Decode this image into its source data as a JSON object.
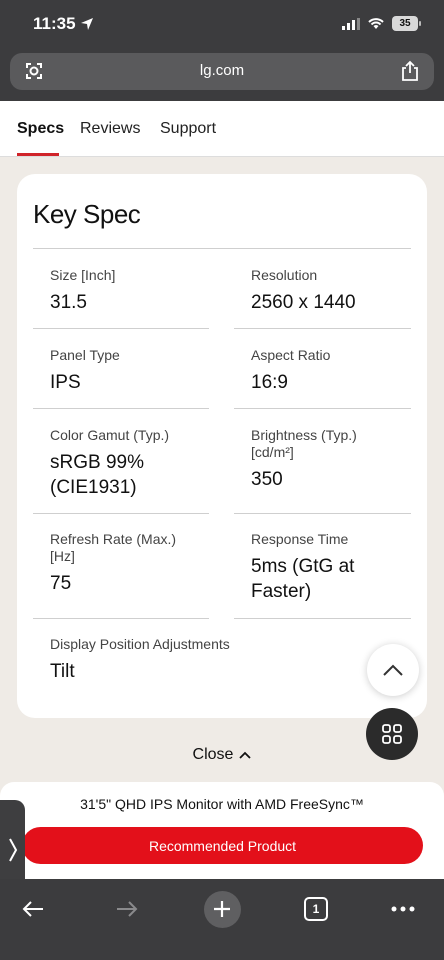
{
  "status": {
    "time": "11:35",
    "battery": "35"
  },
  "browser": {
    "url": "lg.com",
    "tab_count": "1"
  },
  "tabs": [
    {
      "label": "Specs",
      "active": true
    },
    {
      "label": "Reviews",
      "active": false
    },
    {
      "label": "Support",
      "active": false
    }
  ],
  "card": {
    "title": "Key Spec",
    "specs": [
      {
        "label": "Size [Inch]",
        "value": "31.5"
      },
      {
        "label": "Resolution",
        "value": "2560 x 1440"
      },
      {
        "label": "Panel Type",
        "value": "IPS"
      },
      {
        "label": "Aspect Ratio",
        "value": "16:9"
      },
      {
        "label": "Color Gamut (Typ.)",
        "value": "sRGB 99% (CIE1931)"
      },
      {
        "label": "Brightness (Typ.) [cd/m²]",
        "value": "350"
      },
      {
        "label": "Refresh Rate (Max.) [Hz]",
        "value": "75"
      },
      {
        "label": "Response Time",
        "value": "5ms (GtG at Faster)"
      },
      {
        "label": "Display Position Adjustments",
        "value": "Tilt"
      }
    ]
  },
  "close_label": "Close",
  "sheet": {
    "product_name": "31'5\" QHD IPS Monitor with AMD FreeSync™",
    "button_label": "Recommended Product"
  },
  "colors": {
    "accent": "#d0242a",
    "cta": "#e3101a",
    "chrome": "#3c3c3e"
  }
}
